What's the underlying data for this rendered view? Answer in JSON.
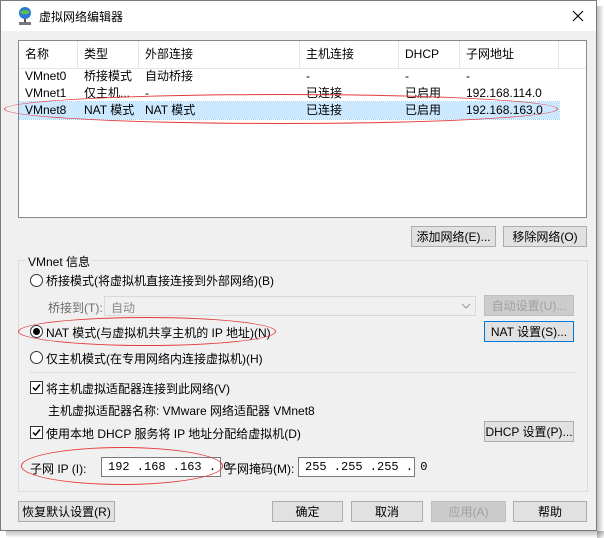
{
  "window": {
    "title": "虚拟网络编辑器"
  },
  "table": {
    "headers": [
      "名称",
      "类型",
      "外部连接",
      "主机连接",
      "DHCP",
      "子网地址"
    ],
    "rows": [
      [
        "VMnet0",
        "桥接模式",
        "自动桥接",
        "-",
        "-",
        "-"
      ],
      [
        "VMnet1",
        "仅主机...",
        "-",
        "已连接",
        "已启用",
        "192.168.114.0"
      ],
      [
        "VMnet8",
        "NAT 模式",
        "NAT 模式",
        "已连接",
        "已启用",
        "192.168.163.0"
      ]
    ],
    "selected_row": 2
  },
  "buttons": {
    "add_network": "添加网络(E)...",
    "remove_network": "移除网络(O)",
    "auto_settings": "自动设置(U)...",
    "nat_settings": "NAT 设置(S)...",
    "dhcp_settings": "DHCP 设置(P)...",
    "restore_defaults": "恢复默认设置(R)",
    "ok": "确定",
    "cancel": "取消",
    "apply": "应用(A)",
    "help": "帮助"
  },
  "vmnet_info": {
    "group_label": "VMnet 信息",
    "bridge_mode": "桥接模式(将虚拟机直接连接到外部网络)(B)",
    "bridge_to_label": "桥接到(T):",
    "bridge_to_value": "自动",
    "nat_mode": "NAT 模式(与虚拟机共享主机的 IP 地址)(N)",
    "host_only_mode": "仅主机模式(在专用网络内连接虚拟机)(H)",
    "selected_mode": "nat",
    "connect_adapter": "将主机虚拟适配器连接到此网络(V)",
    "connect_adapter_checked": true,
    "adapter_name": "主机虚拟适配器名称: VMware 网络适配器 VMnet8",
    "use_dhcp": "使用本地 DHCP 服务将 IP 地址分配给虚拟机(D)",
    "use_dhcp_checked": true,
    "subnet_ip_label": "子网 IP (I):",
    "subnet_ip": "192 .168 .163 . 0",
    "subnet_mask_label": "子网掩码(M):",
    "subnet_mask": "255 .255 .255 . 0"
  },
  "colors": {
    "annotation": "#e43a3a",
    "selection": "#cce8ff",
    "focus": "#0078d7"
  }
}
